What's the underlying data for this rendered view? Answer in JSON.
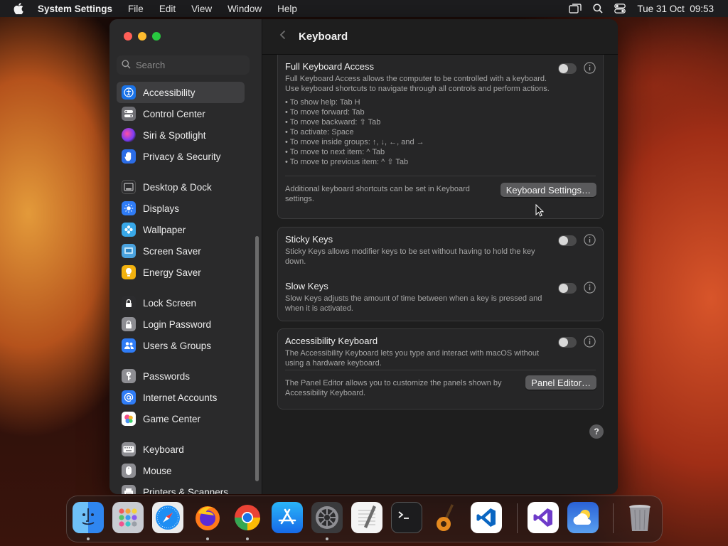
{
  "menubar": {
    "app_name": "System Settings",
    "menus": [
      "File",
      "Edit",
      "View",
      "Window",
      "Help"
    ],
    "clock": "Tue 31 Oct  09:53"
  },
  "sidebar": {
    "search_placeholder": "Search",
    "items": [
      {
        "label": "Accessibility",
        "icon": "accessibility-icon",
        "color": "#1a73e8"
      },
      {
        "label": "Control Center",
        "icon": "control-center-icon",
        "color": "#6e6e73"
      },
      {
        "label": "Siri & Spotlight",
        "icon": "siri-icon",
        "color": "#8a3ffc"
      },
      {
        "label": "Privacy & Security",
        "icon": "hand-icon",
        "color": "#2b6ce6"
      },
      {
        "label": "Desktop & Dock",
        "icon": "desktop-dock-icon",
        "color": "#2c2c2e"
      },
      {
        "label": "Displays",
        "icon": "displays-icon",
        "color": "#2f7cf6"
      },
      {
        "label": "Wallpaper",
        "icon": "wallpaper-icon",
        "color": "#38a8e8"
      },
      {
        "label": "Screen Saver",
        "icon": "screen-saver-icon",
        "color": "#4aa3df"
      },
      {
        "label": "Energy Saver",
        "icon": "energy-saver-icon",
        "color": "#f2b20f"
      },
      {
        "label": "Lock Screen",
        "icon": "lock-icon",
        "color": "#2c2c2e"
      },
      {
        "label": "Login Password",
        "icon": "login-password-icon",
        "color": "#8e8e93"
      },
      {
        "label": "Users & Groups",
        "icon": "users-groups-icon",
        "color": "#2f7cf6"
      },
      {
        "label": "Passwords",
        "icon": "key-icon",
        "color": "#8e8e93"
      },
      {
        "label": "Internet Accounts",
        "icon": "at-icon",
        "color": "#2f7cf6"
      },
      {
        "label": "Game Center",
        "icon": "game-center-icon",
        "color": "#ffffff"
      },
      {
        "label": "Keyboard",
        "icon": "keyboard-icon",
        "color": "#8e8e93"
      },
      {
        "label": "Mouse",
        "icon": "mouse-icon",
        "color": "#8e8e93"
      },
      {
        "label": "Printers & Scanners",
        "icon": "printer-icon",
        "color": "#8e8e93"
      }
    ]
  },
  "content": {
    "title": "Keyboard",
    "full_keyboard_access": {
      "title": "Full Keyboard Access",
      "description": "Full Keyboard Access allows the computer to be controlled with a keyboard. Use keyboard shortcuts to navigate through all controls and perform actions.",
      "tips": [
        "• To show help: Tab H",
        "• To move forward: Tab",
        "• To move backward: ⇧ Tab",
        "• To activate: Space",
        "• To move inside groups: ↑, ↓, ←, and →",
        "• To move to next item: ^ Tab",
        "• To move to previous item: ^ ⇧ Tab"
      ],
      "footer_text": "Additional keyboard shortcuts can be set in Keyboard settings.",
      "button_label": "Keyboard Settings…",
      "enabled": false
    },
    "sticky_keys": {
      "title": "Sticky Keys",
      "description": "Sticky Keys allows modifier keys to be set without having to hold the key down.",
      "enabled": false
    },
    "slow_keys": {
      "title": "Slow Keys",
      "description": "Slow Keys adjusts the amount of time between when a key is pressed and when it is activated.",
      "enabled": false
    },
    "accessibility_keyboard": {
      "title": "Accessibility Keyboard",
      "description": "The Accessibility Keyboard lets you type and interact with macOS without using a hardware keyboard.",
      "footer_text": "The Panel Editor allows you to customize the panels shown by Accessibility Keyboard.",
      "button_label": "Panel Editor…",
      "enabled": false
    },
    "help_label": "?"
  },
  "dock": {
    "apps": [
      "finder-icon",
      "launchpad-icon",
      "safari-icon",
      "firefox-icon",
      "chrome-icon",
      "app-store-icon",
      "system-settings-icon",
      "textedit-icon",
      "terminal-icon",
      "garageband-icon",
      "vscode-icon",
      "visual-studio-icon",
      "weather-icon",
      "trash-icon"
    ]
  }
}
